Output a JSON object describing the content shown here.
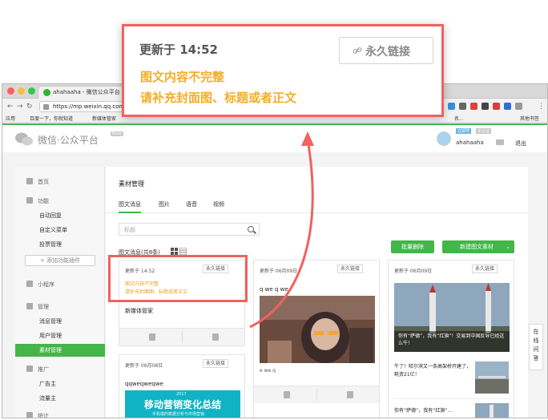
{
  "browser": {
    "tab_title": "ahahaaha - 微信公众平台",
    "url": "https://mp.weixin.qq.com",
    "bookmarks": [
      "应用",
      "百度一下，你就知道",
      "新媒体管家"
    ],
    "bookmark_right_partial": "名...",
    "bookmark_other": "其他书签"
  },
  "header": {
    "brand": "微信·公众平台",
    "beta": "Beta",
    "badge_type": "订阅号",
    "badge_status": "未认证",
    "account_name": "ahahaaha",
    "logout_label": "退出"
  },
  "sidebar": {
    "home": "首页",
    "section_function": "功能",
    "function_items": [
      "自动回复",
      "自定义菜单",
      "投票管理"
    ],
    "add_plugin": "+ 添加功能插件",
    "mini_program": "小程序",
    "section_manage": "管理",
    "manage_items": [
      "消息管理",
      "用户管理"
    ],
    "active_item": "素材管理",
    "section_promote": "推广",
    "promote_items": [
      "广告主",
      "流量主"
    ],
    "section_stats": "统计"
  },
  "main": {
    "title": "素材管理",
    "tabs": [
      "图文消息",
      "图片",
      "语音",
      "视频"
    ],
    "search_placeholder": "标题",
    "count_label": "图文消息(共8条)",
    "bulk_delete": "批量删除",
    "new_article": "新建图文素材"
  },
  "cards": [
    {
      "date": "更新于 14:52",
      "link_label": "永久链接",
      "warn_line1": "图文内容不完整",
      "warn_line2": "请补充封面图、标题或者正文",
      "title": "新媒体管家"
    },
    {
      "date": "更新于 06月09日",
      "link_label": "永久链接",
      "title": "q we q we",
      "subtitle": "e we q"
    },
    {
      "date": "更新于 06月09日",
      "link_label": "永久链接",
      "image_caption": "你有“萨德”，我有“红旗”！交易到中国反导已经这么牛！",
      "item1": "牛了！哈尔滨又一条高架桥开建了，耗资21亿！",
      "item2": "你有“萨德”，我有“红旗”..."
    },
    {
      "date": "更新于 06月08日",
      "link_label": "永久链接",
      "title": "qqweqweqwe",
      "banner_text": "移动营销变化总结",
      "banner_year": "2017",
      "banner_sub": "手机端的数据分析与市场营销"
    }
  ],
  "feedback": "在线问答",
  "callout": {
    "date": "更新于 14:52",
    "link_label": "永久链接",
    "warn_line1": "图文内容不完整",
    "warn_line2": "请补充封面图、标题或者正文"
  },
  "colors": {
    "accent": "#44b549",
    "highlight": "#f0625f",
    "warning": "#f5ac26"
  }
}
